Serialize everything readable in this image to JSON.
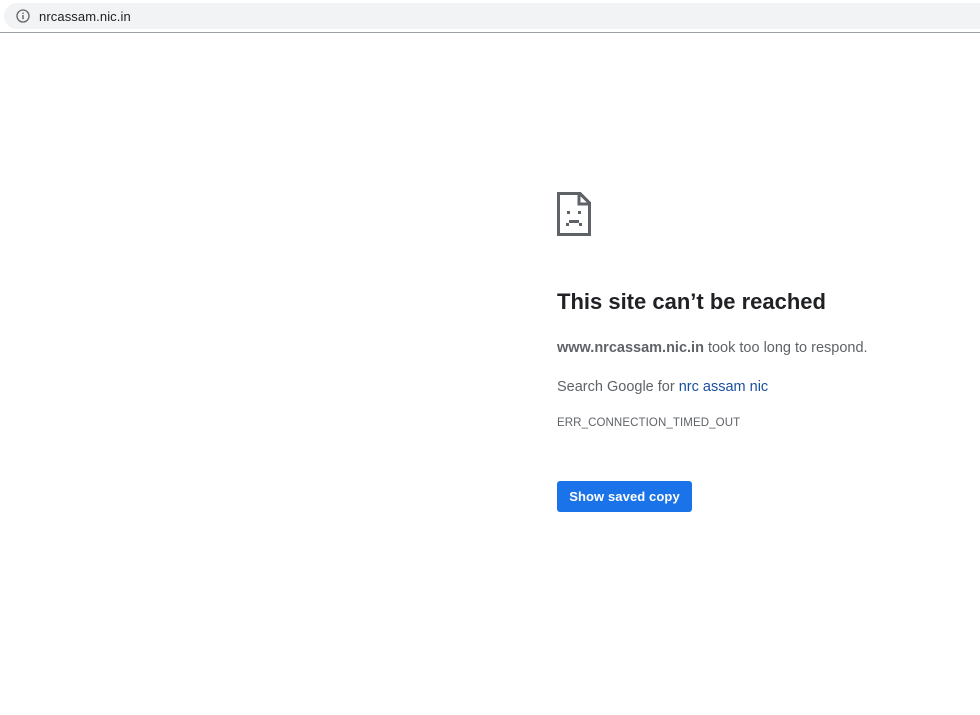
{
  "browser": {
    "url": "nrcassam.nic.in",
    "security_icon": "info-icon"
  },
  "error": {
    "icon": "sad-page-icon",
    "title": "This site can’t be reached",
    "host": "www.nrcassam.nic.in",
    "message_suffix": " took too long to respond.",
    "search_prefix": "Search Google for ",
    "search_query": "nrc assam nic",
    "code": "ERR_CONNECTION_TIMED_OUT",
    "button_label": "Show saved copy"
  },
  "colors": {
    "button": "#1a73e8",
    "link": "#1a4fa0",
    "text": "#202124",
    "secondary_text": "#5f6368"
  }
}
